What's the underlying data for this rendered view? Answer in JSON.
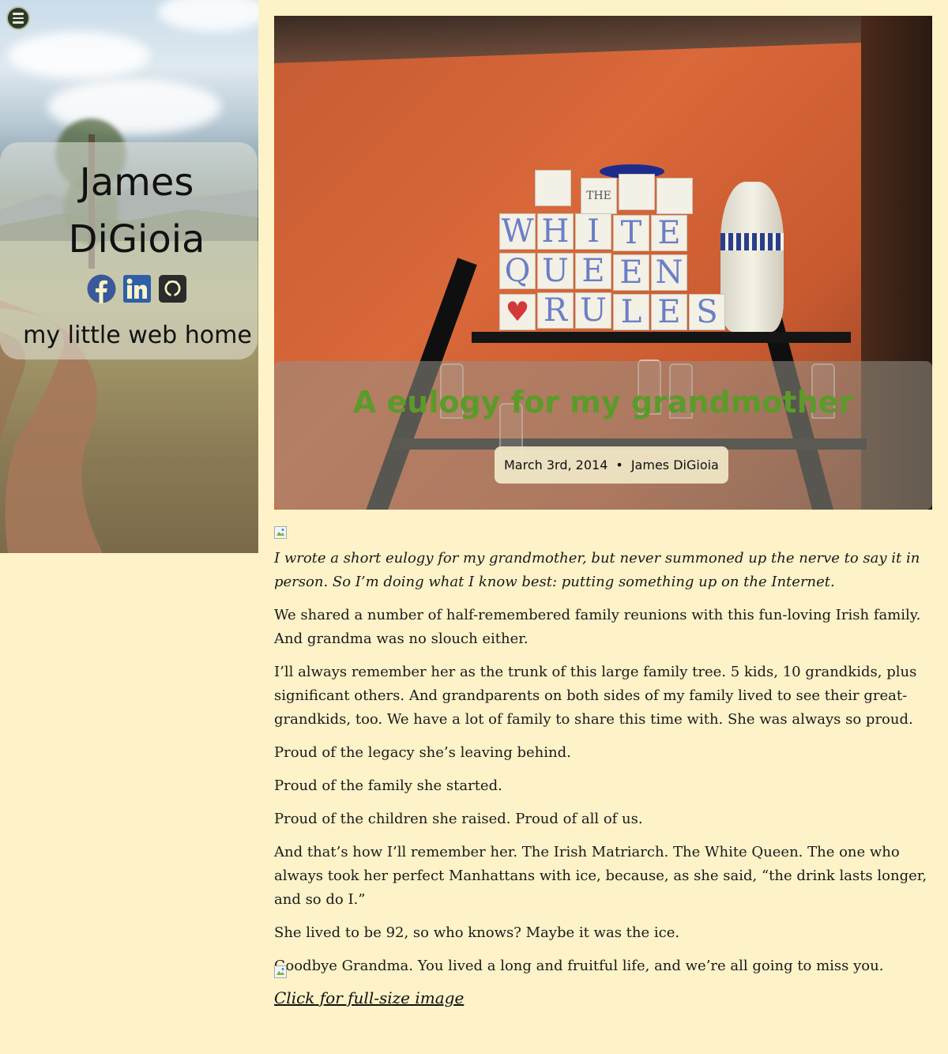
{
  "sidebar": {
    "menu_icon": "hamburger-menu-icon",
    "site_name": "James DiGioia",
    "tagline": "my little web home",
    "social": [
      {
        "icon": "facebook-icon",
        "color": "#3b5998"
      },
      {
        "icon": "linkedin-icon",
        "color": "#2e5fa8"
      },
      {
        "icon": "github-icon",
        "color": "#2b2b2b"
      }
    ]
  },
  "post": {
    "title": "A eulogy for my grandmother",
    "date": "March 3rd, 2014",
    "separator": "•",
    "author": "James DiGioia",
    "hero_blocks": {
      "row1": [
        "THE"
      ],
      "row2": [
        "W",
        "H",
        "I",
        "T",
        "E"
      ],
      "row3": [
        "Q",
        "U",
        "E",
        "E",
        "N"
      ],
      "row4": [
        "R",
        "U",
        "L",
        "E",
        "S"
      ]
    },
    "paragraphs": [
      "I wrote a short eulogy for my grandmother, but never summoned up the nerve to say it in person. So I’m doing what I know best: putting something up on the Internet.",
      "We shared a number of half-remembered family reunions with this fun-loving Irish family. And grandma was no slouch either.",
      "I’ll always remember her as the trunk of this large family tree. 5 kids, 10 grandkids, plus significant others. And grandparents on both sides of my family lived to see their great-grandkids, too. We have a lot of family to share this time with. She was always so proud.",
      "Proud of the legacy she’s leaving behind.",
      "Proud of the family she started.",
      "Proud of the children she raised. Proud of all of us.",
      "And that’s how I’ll remember her. The Irish Matriarch. The White Queen. The one who always took her perfect Manhattans with ice, because, as she said, “the drink lasts longer, and so do I.”",
      "She lived to be 92, so who knows? Maybe it was the ice.",
      "Goodbye Grandma. You lived a long and fruitful life, and we’re all going to miss you."
    ],
    "full_size_link": "Click for full-size image"
  },
  "colors": {
    "page_bg": "#fdf2c8",
    "title_green": "#5c9a2a"
  }
}
